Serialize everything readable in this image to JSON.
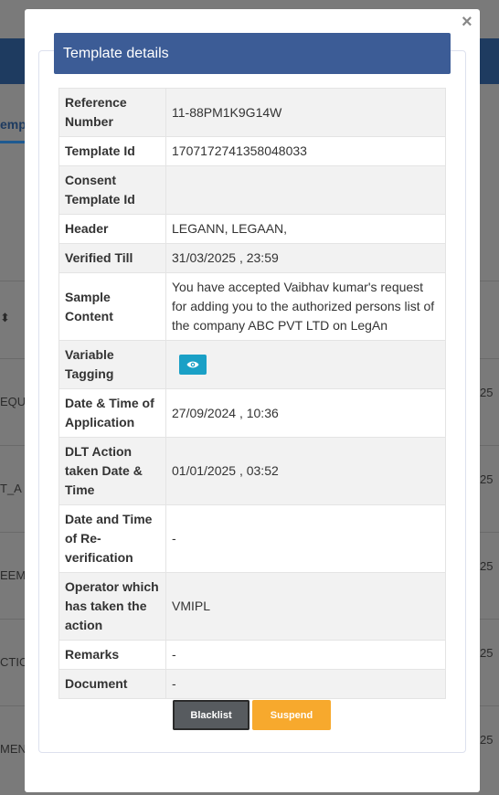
{
  "background": {
    "tab_label": "emp",
    "side_texts": [
      "EQUI",
      "T_A",
      "EEME",
      "CTIO",
      "MEN"
    ],
    "right_texts": [
      "25",
      "25",
      "25",
      "25",
      "25"
    ]
  },
  "modal": {
    "close_label": "×",
    "title": "Template details",
    "rows": [
      {
        "label": "Reference Number",
        "value": "11-88PM1K9G14W"
      },
      {
        "label": "Template Id",
        "value": "1707172741358048033"
      },
      {
        "label": "Consent Template Id",
        "value": ""
      },
      {
        "label": "Header",
        "value": "LEGANN, LEGAAN,"
      },
      {
        "label": "Verified Till",
        "value": "31/03/2025 , 23:59"
      },
      {
        "label": "Sample Content",
        "value": "You have accepted Vaibhav kumar's request for adding you to the authorized persons list of the company ABC PVT LTD on LegAn"
      },
      {
        "label": "Variable Tagging",
        "value": ""
      },
      {
        "label": "Date & Time of Application",
        "value": "27/09/2024 , 10:36"
      },
      {
        "label": "DLT Action taken Date & Time",
        "value": "01/01/2025 , 03:52"
      },
      {
        "label": "Date and Time of Re-verification",
        "value": "-"
      },
      {
        "label": "Operator which has taken the action",
        "value": "VMIPL"
      },
      {
        "label": "Remarks",
        "value": "-"
      },
      {
        "label": "Document",
        "value": "-"
      }
    ],
    "buttons": {
      "blacklist": "Blacklist",
      "suspend": "Suspend"
    },
    "colors": {
      "title_bar": "#3c5c96",
      "eye_button": "#1aa0c6",
      "suspend": "#f7a92d",
      "blacklist": "#575b5f"
    }
  }
}
